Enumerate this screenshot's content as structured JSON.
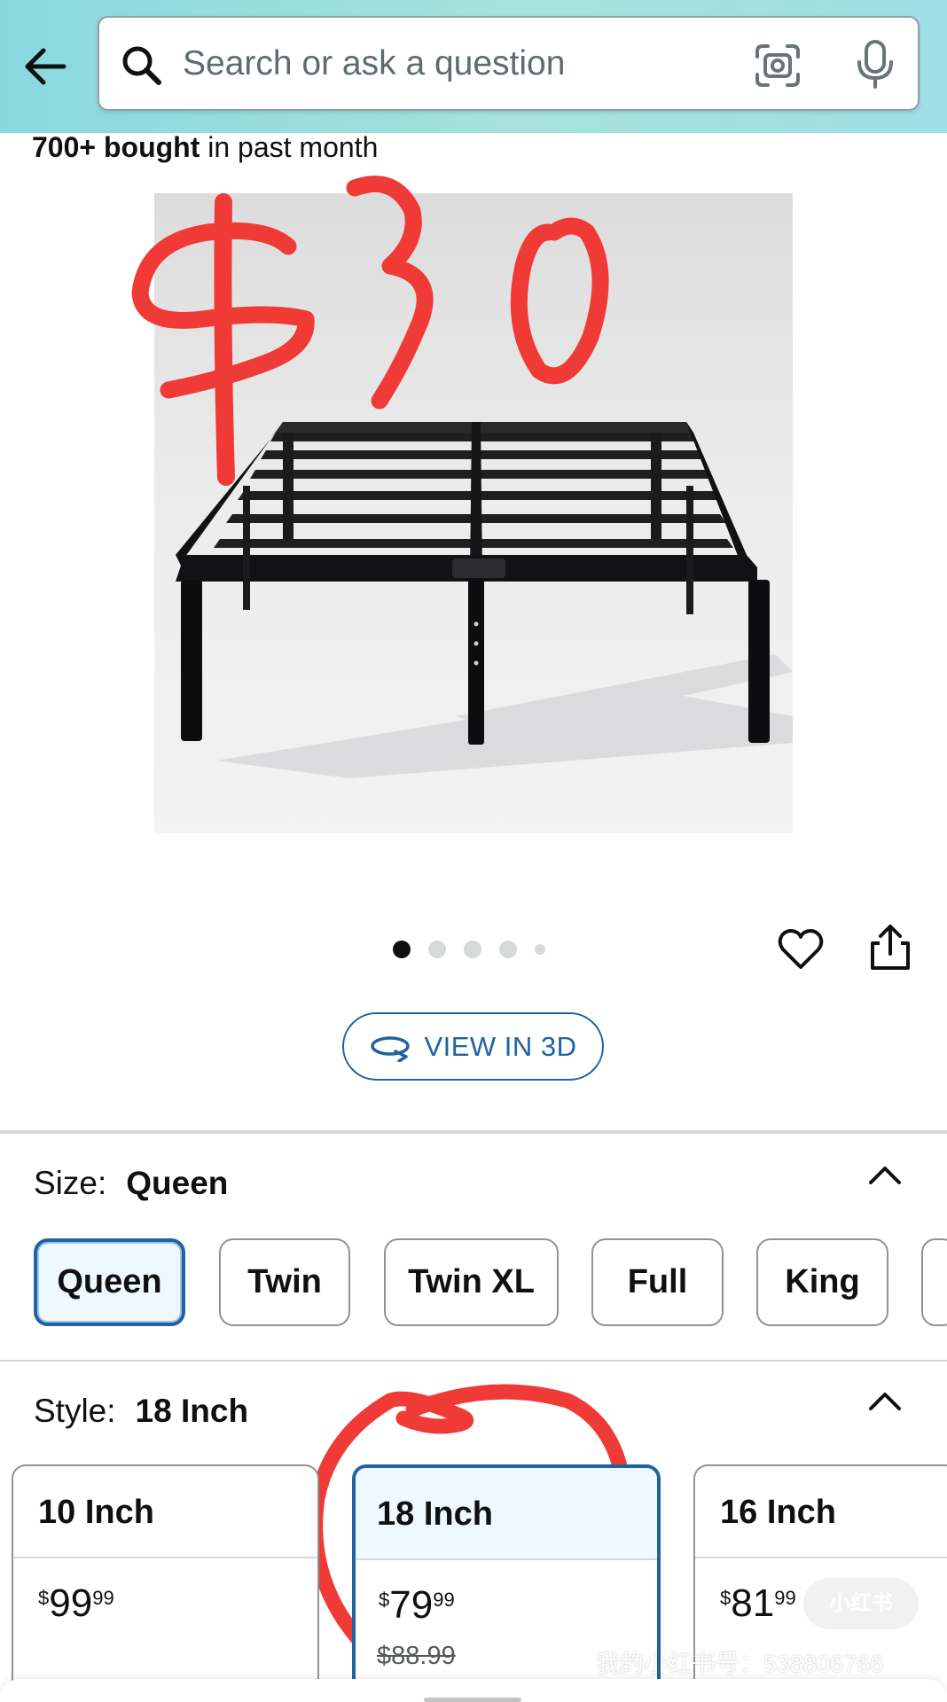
{
  "header": {
    "search_placeholder": "Search or ask a question",
    "icons": [
      "back-arrow-icon",
      "search-icon",
      "camera-lens-icon",
      "microphone-icon"
    ]
  },
  "product": {
    "bought_count": "700+ bought",
    "bought_suffix": " in past month",
    "image_annotation": "$30",
    "carousel_total_dots": 5,
    "carousel_active_index": 0,
    "view_3d_label": "VIEW IN 3D"
  },
  "size": {
    "label": "Size:",
    "selected": "Queen",
    "options": [
      "Queen",
      "Twin",
      "Twin XL",
      "Full",
      "King"
    ]
  },
  "style": {
    "label": "Style:",
    "selected": "18 Inch",
    "cards": [
      {
        "name": "10 Inch",
        "currency": "$",
        "whole": "99",
        "fraction": "99",
        "list_price": ""
      },
      {
        "name": "18 Inch",
        "currency": "$",
        "whole": "79",
        "fraction": "99",
        "list_price": "$88.99"
      },
      {
        "name": "16 Inch",
        "currency": "$",
        "whole": "81",
        "fraction": "99",
        "list_price": ""
      }
    ]
  },
  "watermark": {
    "text": "我的小红书号：538806766",
    "badge": "小红书"
  },
  "colors": {
    "header_gradient_start": "#89d8e0",
    "header_gradient_end": "#9fdfe6",
    "link_blue": "#2162a1",
    "selected_fill": "#edf8ff",
    "annotation_red": "#f03a35"
  }
}
